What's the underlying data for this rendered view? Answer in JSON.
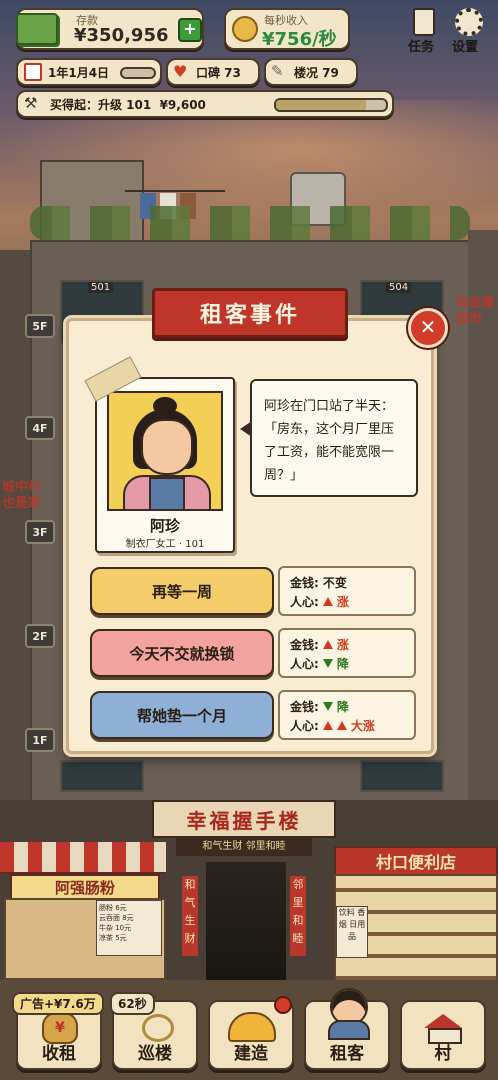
{
  "hud": {
    "savings_label": "存款",
    "savings_value": "¥350,956",
    "income_label": "每秒收入",
    "income_value": "¥756/秒",
    "tasks_label": "任务",
    "settings_label": "设置",
    "date": "1年1月4日",
    "reputation_label": "口碑 73",
    "building_label": "楼况 79",
    "afford_text": "买得起：升级 101  ¥9,600",
    "afford_progress": 0.82
  },
  "floors": [
    "5F",
    "4F",
    "3F",
    "2F",
    "1F"
  ],
  "room_numbers": [
    "501",
    "504"
  ],
  "event": {
    "title": "租客事件",
    "tenant_name": "阿珍",
    "tenant_info": "制衣厂女工 · 101",
    "dialog": "阿珍在门口站了半天：「房东，这个月厂里压了工资，能不能宽限一周？」",
    "choices": [
      {
        "label": "再等一周",
        "money_label": "金钱:",
        "money_value": "不变",
        "heart_label": "人心:",
        "heart_value": "涨"
      },
      {
        "label": "今天不交就换锁",
        "money_label": "金钱:",
        "money_value": "涨",
        "heart_label": "人心:",
        "heart_value": "降"
      },
      {
        "label": "帮她垫一个月",
        "money_label": "金钱:",
        "money_value": "降",
        "heart_label": "人心:",
        "heart_value": "大涨"
      }
    ]
  },
  "scene": {
    "building_sign": "幸福握手楼",
    "sub_sign": "和气生财  邻里和睦",
    "left_shop": "阿强肠粉",
    "right_shop": "村口便利店",
    "menu": [
      "肠粉  6元",
      "云吞面  8元",
      "牛杂  10元",
      "凉茶  5元"
    ],
    "couplet_left": "和气生财",
    "couplet_right": "邻里和睦",
    "shop_side": "饮料 香烟 日用品",
    "wall_left": "城中村 也是家",
    "wall_right": "有故事 城市"
  },
  "bottom_bar": {
    "ad_badge": "广告+¥7.6万",
    "timer_badge": "62秒",
    "tabs": [
      "收租",
      "巡楼",
      "建造",
      "租客",
      "村"
    ]
  },
  "colors": {
    "title_red": "#c0352a",
    "btn_yellow": "#f5cc6a",
    "btn_pink": "#f2a3a0",
    "btn_blue": "#8fb0d6",
    "money_green": "#2c8a3e"
  }
}
